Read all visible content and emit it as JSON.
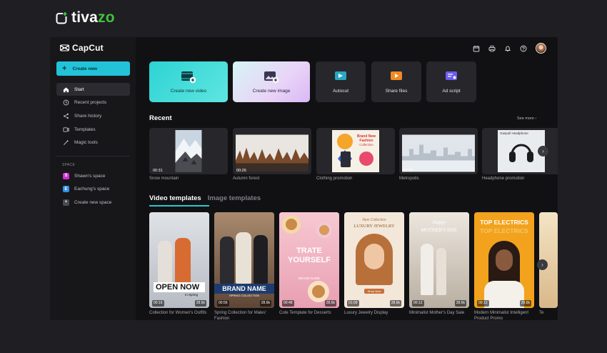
{
  "brand": {
    "name_a": "tiva",
    "name_b": "zo",
    "accent": "#3fc33f"
  },
  "app": {
    "logo": "CapCut",
    "create_label": "Create new",
    "nav": [
      {
        "icon": "home-icon",
        "label": "Start"
      },
      {
        "icon": "clock-icon",
        "label": "Recent projects"
      },
      {
        "icon": "share-icon",
        "label": "Share history"
      },
      {
        "icon": "templates-icon",
        "label": "Templates"
      },
      {
        "icon": "magic-wand-icon",
        "label": "Magic tools"
      }
    ],
    "space_header": "SPACE",
    "spaces": [
      {
        "letter": "S",
        "label": "Shawn's space",
        "color": "#d12fd6"
      },
      {
        "letter": "E",
        "label": "Eachung's space",
        "color": "#2f8fe6"
      },
      {
        "letter": "+",
        "label": "Create new space",
        "color": "#4a4a52"
      }
    ],
    "accent": "#22c3d8"
  },
  "tiles": {
    "video": "Create new video",
    "image": "Create new image",
    "autocut": "Autocut",
    "share": "Share files",
    "ad": "Ad script"
  },
  "recent": {
    "title": "Recent",
    "see_more": "See more",
    "items": [
      {
        "name": "Snow mountain",
        "duration": "00:31"
      },
      {
        "name": "Autumn forest",
        "duration": "00:26"
      },
      {
        "name": "Clothing promotion",
        "duration": ""
      },
      {
        "name": "Metropolis",
        "duration": "00:15"
      },
      {
        "name": "Headphone promotion",
        "duration": ""
      }
    ],
    "headphone_label": "Gaspull Headphone"
  },
  "tabs": {
    "video": "Video templates",
    "image": "Image templates"
  },
  "templates": [
    {
      "name": "Collection for Women's Outfits",
      "duration": "00:16",
      "likes": "28.6k",
      "overlay_a": "OPEN NOW",
      "overlay_b": "In Spring"
    },
    {
      "name": "Spring Collection for Males' Fashion",
      "duration": "00:56",
      "likes": "28.6k",
      "overlay_a": "BRAND NAME",
      "overlay_b": "SPRING COLLECTION"
    },
    {
      "name": "Cute Template for Desserts",
      "duration": "00:48",
      "likes": "28.6k",
      "overlay_a": "TRATE",
      "overlay_b": "YOURSELF",
      "overlay_c": "BRAND NAME"
    },
    {
      "name": "Luxury Jewelry Display",
      "duration": "01:09",
      "likes": "28.6k",
      "overlay_a": "New Collection",
      "overlay_b": "LUXURY JEWELRY",
      "overlay_c": "Shop Now"
    },
    {
      "name": "Minimalist Mother's Day Sale",
      "duration": "00:12",
      "likes": "28.6k",
      "overlay_a": "Happy",
      "overlay_b": "MOTHER'S DAY"
    },
    {
      "name": "Modern Minimalist Intelligent Product Promo",
      "duration": "00:12",
      "likes": "28.6k",
      "overlay_a": "TOP ELECTRICS",
      "overlay_b": "TOP ELECTRICS"
    },
    {
      "name": "Te",
      "duration": "",
      "likes": ""
    }
  ]
}
